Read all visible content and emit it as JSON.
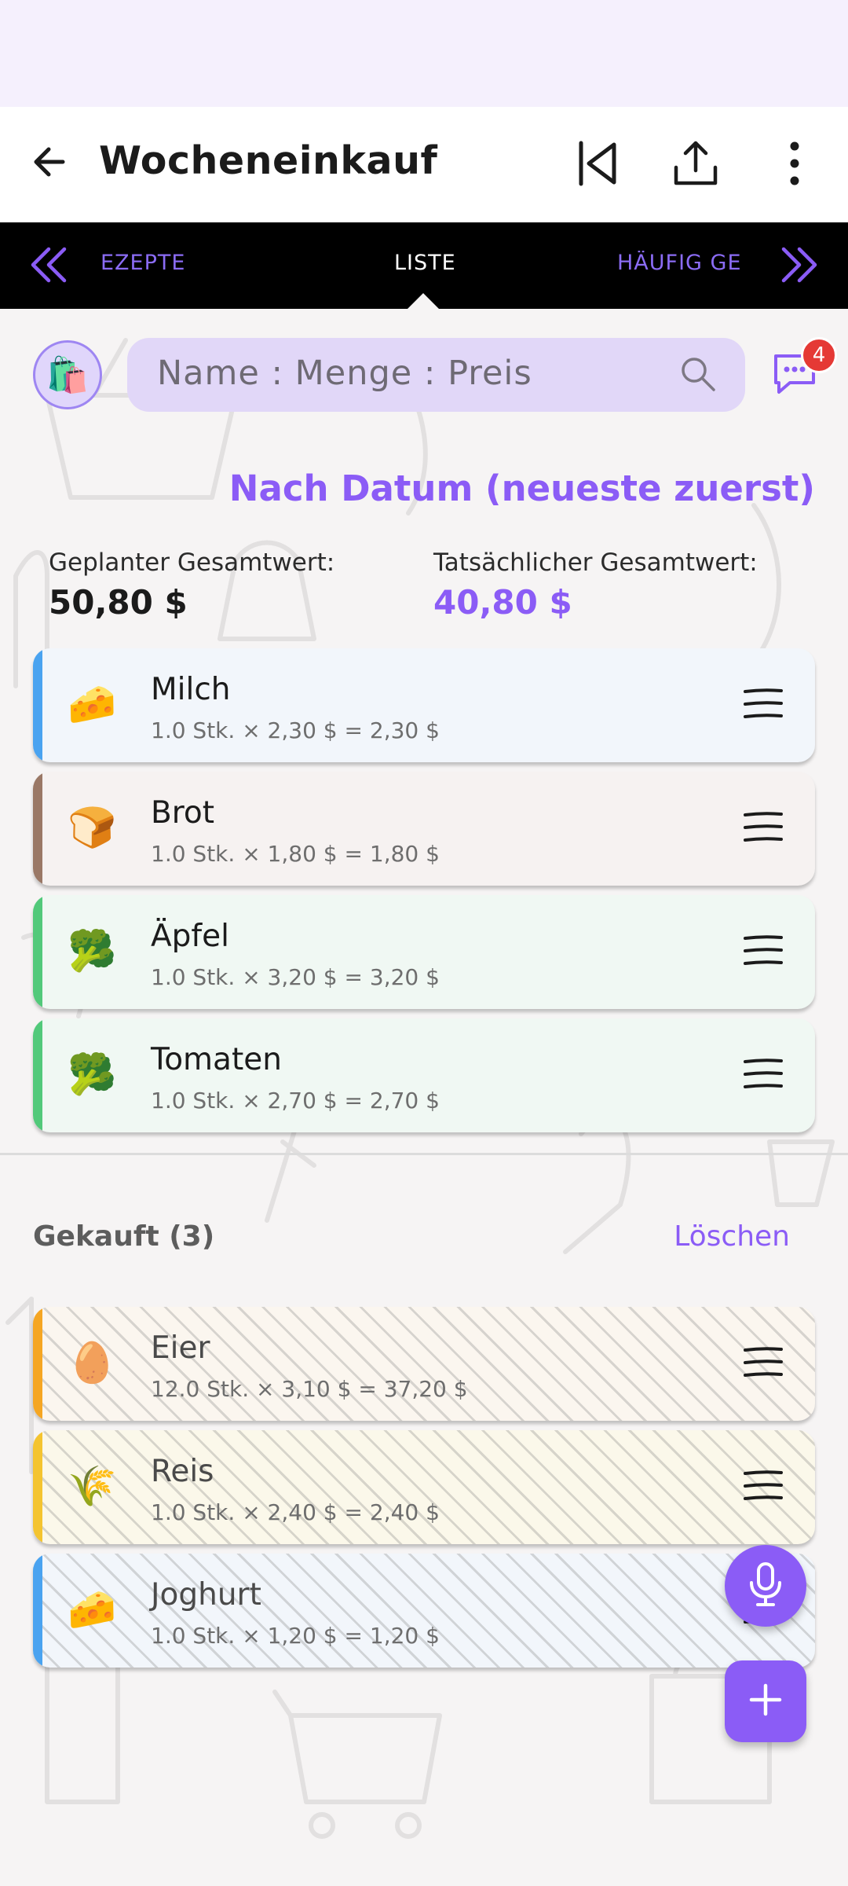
{
  "app": {
    "title": "Wocheneinkauf"
  },
  "tabs": {
    "left": "EZEPTE",
    "center": "LISTE",
    "right": "HÄUFIG GE"
  },
  "search": {
    "placeholder": "Name : Menge : Preis",
    "badge_count": "4"
  },
  "sort_label": "Nach Datum (neueste zuerst)",
  "totals": {
    "planned_label": "Geplanter Gesamtwert:",
    "planned_value": "50,80 $",
    "actual_label": "Tatsächlicher Gesamtwert:",
    "actual_value": "40,80 $"
  },
  "items": [
    {
      "emoji": "🧀",
      "name": "Milch",
      "detail": "1.0 Stk. × 2,30 $ = 2,30 $",
      "stripe": "#4aa3f0",
      "bg": "#f2f6fb"
    },
    {
      "emoji": "🍞",
      "name": "Brot",
      "detail": "1.0 Stk. × 1,80 $ = 1,80 $",
      "stripe": "#9a7866",
      "bg": "#f6f2f1"
    },
    {
      "emoji": "🥦",
      "name": "Äpfel",
      "detail": "1.0 Stk. × 3,20 $ = 3,20 $",
      "stripe": "#52c97a",
      "bg": "#f0f8f3"
    },
    {
      "emoji": "🥦",
      "name": "Tomaten",
      "detail": "1.0 Stk. × 2,70 $ = 2,70 $",
      "stripe": "#52c97a",
      "bg": "#f0f8f3"
    }
  ],
  "bought": {
    "title": "Gekauft (3)",
    "clear_label": "Löschen",
    "items": [
      {
        "emoji": "🥚",
        "name": "Eier",
        "detail": "12.0 Stk. × 3,10 $ = 37,20 $",
        "stripe": "#f5a623",
        "bg": "#fbf6ef"
      },
      {
        "emoji": "🌾",
        "name": "Reis",
        "detail": "1.0 Stk. × 2,40 $ = 2,40 $",
        "stripe": "#f4c430",
        "bg": "#fbf8ea"
      },
      {
        "emoji": "🧀",
        "name": "Joghurt",
        "detail": "1.0 Stk. × 1,20 $ = 1,20 $",
        "stripe": "#4aa3f0",
        "bg": "#f2f6fb"
      }
    ]
  },
  "colors": {
    "accent": "#8b5cf6",
    "tab_bar": "#000000",
    "status_bar": "#f5f0fd"
  }
}
